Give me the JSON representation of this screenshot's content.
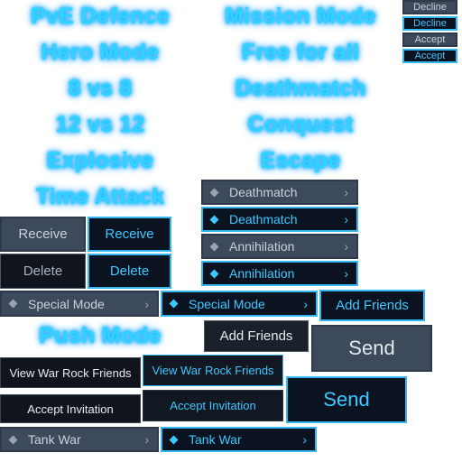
{
  "glow_labels": {
    "pve_defence": "PvE Defence",
    "mission_mode": "Mission Mode",
    "hero_mode": "Hero Mode",
    "free_for_all": "Free for all",
    "eight_vs_eight": "8 vs 8",
    "deathmatch": "Deathmatch",
    "twelve_vs_twelve": "12 vs 12",
    "conquest": "Conquest",
    "explosive": "Explosive",
    "escape": "Escape",
    "time_attack": "Time Attack",
    "push_mode": "Push Mode"
  },
  "small_buttons": {
    "decline_normal": "Decline",
    "decline_active": "Decline",
    "accept_normal": "Accept",
    "accept_active": "Accept"
  },
  "mode_rows": {
    "deathmatch_normal": "Deathmatch",
    "deathmatch_active": "Deathmatch",
    "annihilation_normal": "Annihilation",
    "annihilation_active": "Annihilation",
    "special_normal": "Special Mode",
    "special_active": "Special Mode",
    "tank_normal": "Tank War",
    "tank_active": "Tank War"
  },
  "buttons": {
    "receive_normal": "Receive",
    "receive_active": "Receive",
    "delete_normal": "Delete",
    "delete_active": "Delete",
    "add_friends_active": "Add Friends",
    "add_friends_normal": "Add Friends",
    "send_normal": "Send",
    "send_active": "Send",
    "view_war_rock_friends_normal": "View War Rock Friends",
    "view_war_rock_friends_active": "View War Rock Friends",
    "accept_invitation_normal": "Accept Invitation",
    "accept_invitation_active": "Accept Invitation"
  },
  "icons": {
    "row_bullet": "diamond-icon",
    "row_arrow": "chevron-right-icon"
  },
  "colors": {
    "glow_text": "#2fd3ff",
    "slate_bg": "#3d4a5c",
    "dark_bg": "#10151d",
    "active_border": "#33b8f2",
    "active_text": "#3ec8ff"
  }
}
